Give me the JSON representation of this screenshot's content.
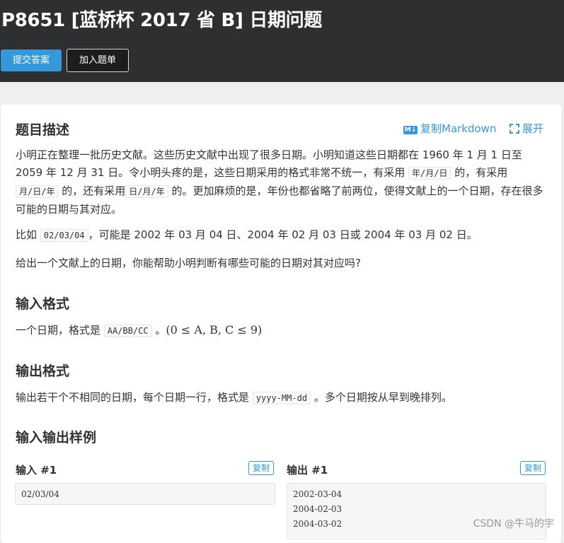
{
  "header": {
    "title": "P8651 [蓝桥杯 2017 省 B] 日期问题",
    "submit_label": "提交答案",
    "add_label": "加入题单"
  },
  "description": {
    "heading": "题目描述",
    "copy_markdown": "复制Markdown",
    "expand": "展开",
    "p1": {
      "t1": "小明正在整理一批历史文献。这些历史文献中出现了很多日期。小明知道这些日期都在 1960 年 1 月 1 日至 2059 年 12 月 31 日。令小明头疼的是，这些日期采用的格式非常不统一，有采用",
      "c1": "年/月/日",
      "t2": "的，有采用",
      "c2": "月/日/年",
      "t3": "的，还有采用",
      "c3": "日/月/年",
      "t4": "的。更加麻烦的是，年份也都省略了前两位，使得文献上的一个日期，存在很多可能的日期与其对应。"
    },
    "p2": {
      "t1": "比如",
      "c1": "02/03/04",
      "t2": "，可能是 2002 年 03 月 04 日、2004 年 02 月 03 日或 2004 年 03 月 02 日。"
    },
    "p3": "给出一个文献上的日期，你能帮助小明判断有哪些可能的日期对其对应吗?"
  },
  "input_format": {
    "heading": "输入格式",
    "t1": "一个日期，格式是",
    "c1": "AA/BB/CC",
    "t2": "。",
    "math": "(0 ≤ A, B, C ≤ 9)"
  },
  "output_format": {
    "heading": "输出格式",
    "t1": "输出若干个不相同的日期，每个日期一行，格式是",
    "c1": "yyyy-MM-dd",
    "t2": "。多个日期按从早到晚排列。"
  },
  "samples": {
    "heading": "输入输出样例",
    "input_label": "输入 #1",
    "output_label": "输出 #1",
    "copy_label": "复制",
    "input_lines": [
      "02/03/04"
    ],
    "output_lines": [
      "2002-03-04",
      "2004-02-03",
      "2004-03-02"
    ]
  },
  "watermark": "CSDN @牛马的宇",
  "colors": {
    "header_bg": "#2e2f30",
    "accent": "#3498db",
    "page_bg": "#efefef"
  },
  "icons": [
    "markdown-icon",
    "expand-icon"
  ]
}
